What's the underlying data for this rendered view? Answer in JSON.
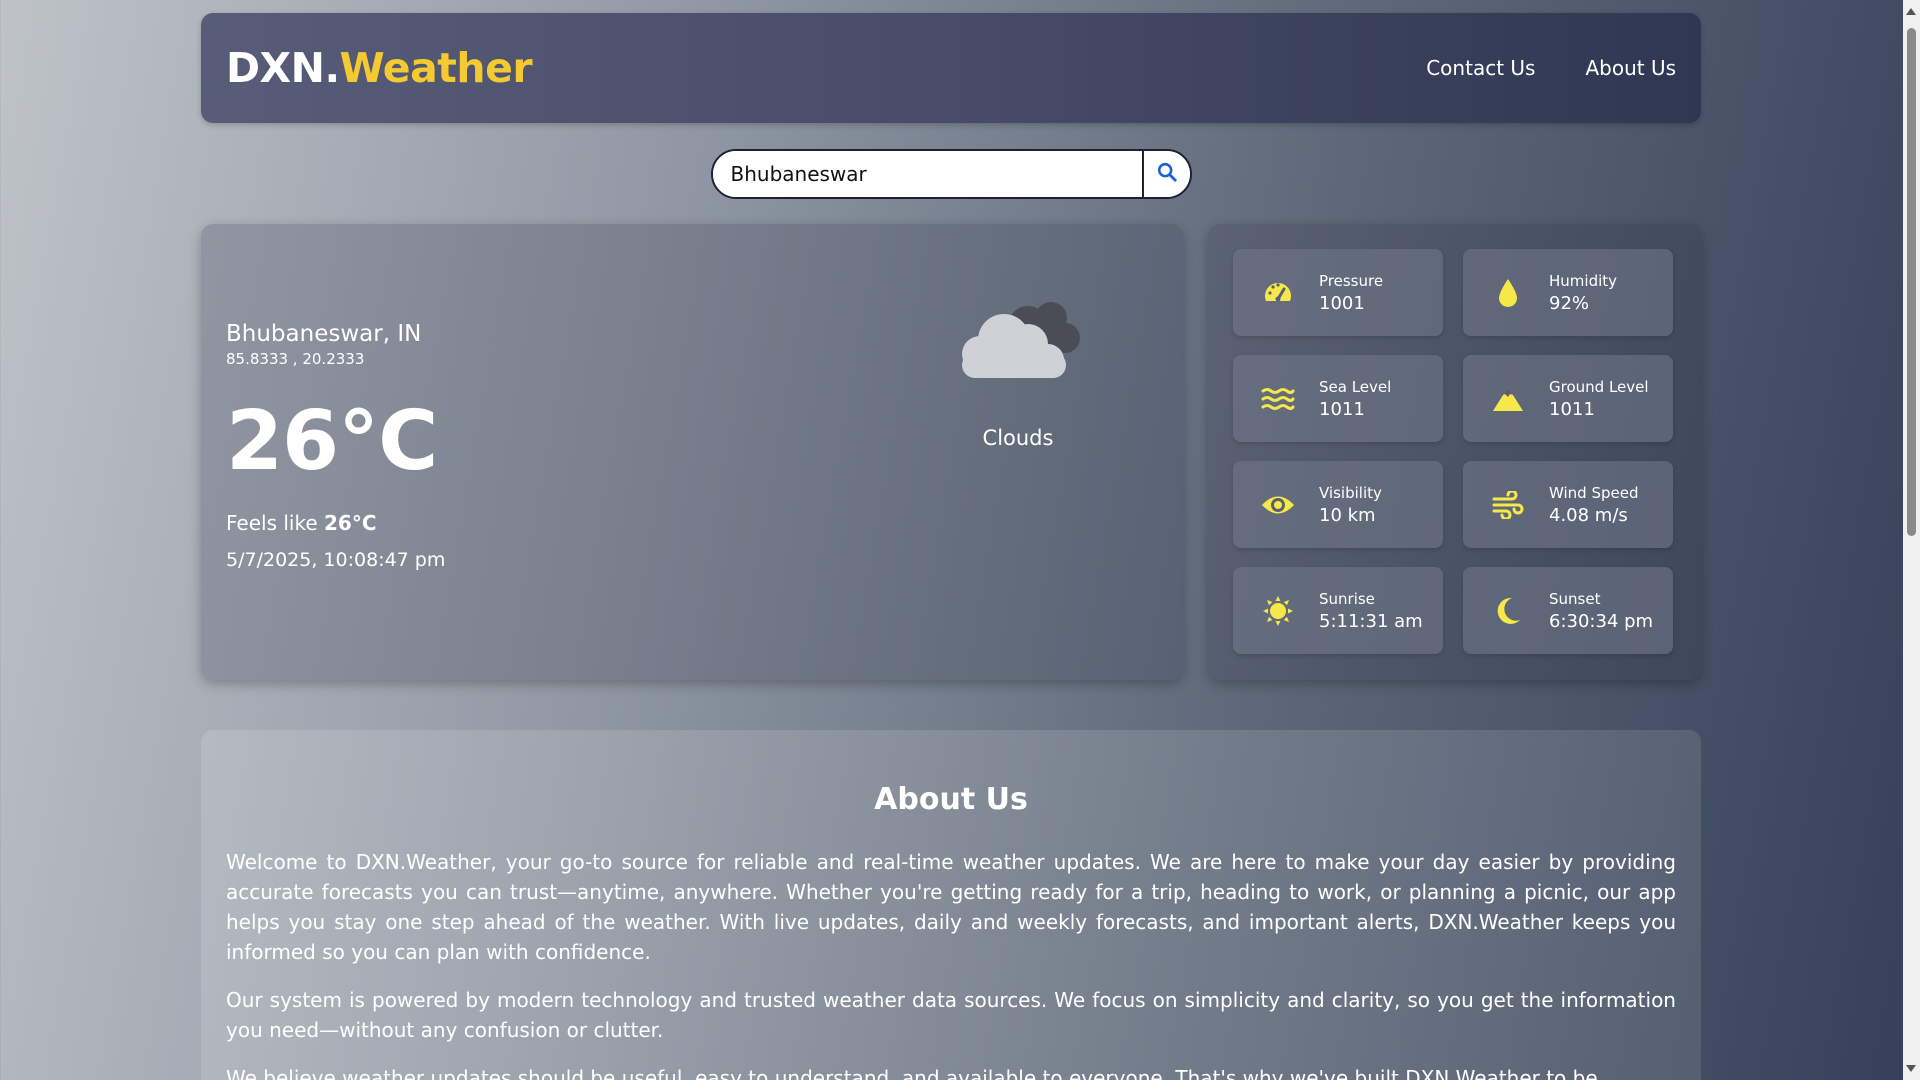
{
  "header": {
    "logo_part1": "DXN.",
    "logo_part2": "Weather",
    "nav": [
      "Contact Us",
      "About Us"
    ]
  },
  "search": {
    "value": "Bhubaneswar",
    "icon": "search-icon"
  },
  "weather": {
    "city": "Bhubaneswar, IN",
    "coords": "85.8333 , 20.2333",
    "temp": "26°C",
    "feels_prefix": "Feels like ",
    "feels_value": "26°C",
    "datetime": "5/7/2025, 10:08:47 pm",
    "condition": "Clouds",
    "condition_icon": "clouds-icon"
  },
  "stats": [
    {
      "label": "Pressure",
      "value": "1001",
      "icon": "gauge-icon"
    },
    {
      "label": "Humidity",
      "value": "92%",
      "icon": "droplet-icon"
    },
    {
      "label": "Sea Level",
      "value": "1011",
      "icon": "water-icon"
    },
    {
      "label": "Ground Level",
      "value": "1011",
      "icon": "mountain-icon"
    },
    {
      "label": "Visibility",
      "value": "10 km",
      "icon": "eye-icon"
    },
    {
      "label": "Wind Speed",
      "value": "4.08 m/s",
      "icon": "wind-icon"
    },
    {
      "label": "Sunrise",
      "value": "5:11:31 am",
      "icon": "sun-icon"
    },
    {
      "label": "Sunset",
      "value": "6:30:34 pm",
      "icon": "moon-icon"
    }
  ],
  "about": {
    "title": "About Us",
    "paragraphs": [
      "Welcome to DXN.Weather, your go-to source for reliable and real-time weather updates. We are here to make your day easier by providing accurate forecasts you can trust—anytime, anywhere. Whether you're getting ready for a trip, heading to work, or planning a picnic, our app helps you stay one step ahead of the weather. With live updates, daily and weekly forecasts, and important alerts, DXN.Weather keeps you informed so you can plan with confidence.",
      "Our system is powered by modern technology and trusted weather data sources. We focus on simplicity and clarity, so you get the information you need—without any confusion or clutter.",
      "We believe weather updates should be useful, easy to understand, and available to everyone. That's why we've built DXN.Weather to be"
    ]
  },
  "colors": {
    "accent": "#f5c932",
    "icon": "#f7e84a"
  }
}
